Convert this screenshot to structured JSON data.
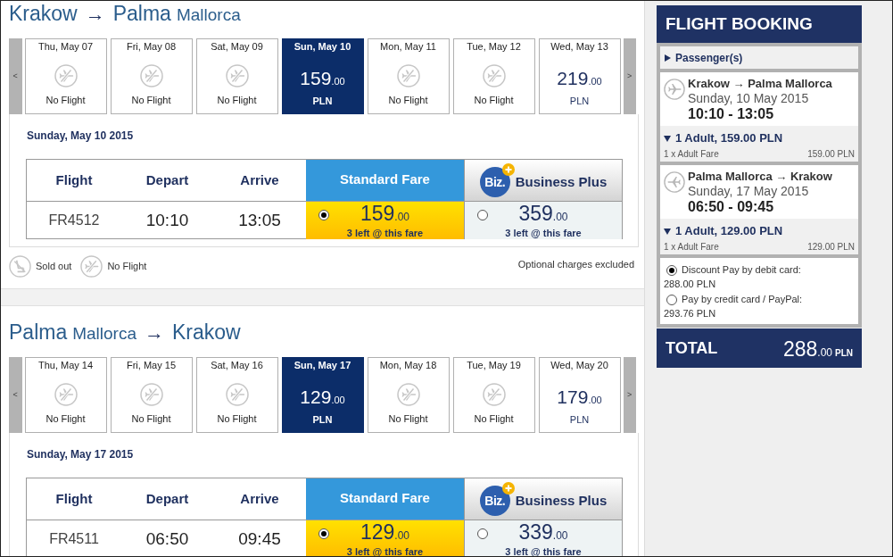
{
  "sections": [
    {
      "route": {
        "origin": {
          "city": "Krakow"
        },
        "arrow": "→",
        "destination": {
          "city": "Palma",
          "region": "Mallorca"
        }
      },
      "prev": "<",
      "next": ">",
      "days": [
        {
          "date": "Thu, May 07",
          "kind": "no_flight",
          "status": "No Flight",
          "selected": false
        },
        {
          "date": "Fri, May 08",
          "kind": "no_flight",
          "status": "No Flight",
          "selected": false
        },
        {
          "date": "Sat, May 09",
          "kind": "no_flight",
          "status": "No Flight",
          "selected": false
        },
        {
          "date": "Sun, May 10",
          "kind": "price",
          "amount": "159",
          "cents": ".00",
          "currency": "PLN",
          "selected": true
        },
        {
          "date": "Mon, May 11",
          "kind": "no_flight",
          "status": "No Flight",
          "selected": false
        },
        {
          "date": "Tue, May 12",
          "kind": "no_flight",
          "status": "No Flight",
          "selected": false
        },
        {
          "date": "Wed, May 13",
          "kind": "price",
          "amount": "219",
          "cents": ".00",
          "currency": "PLN",
          "selected": false
        }
      ],
      "heading": "Sunday, May 10 2015",
      "table": {
        "columns": [
          "Flight",
          "Depart",
          "Arrive"
        ],
        "fares": [
          {
            "kind": "standard",
            "label": "Standard Fare"
          },
          {
            "kind": "business",
            "badge": "Biz.",
            "label": "Business Plus"
          }
        ],
        "rows": [
          {
            "flight": "FR4512",
            "depart": "10:10",
            "arrive": "13:05",
            "fares": [
              {
                "amount": "159",
                "cents": ".00",
                "note": "3 left @ this fare",
                "selected": true
              },
              {
                "amount": "359",
                "cents": ".00",
                "note": "3 left @ this fare",
                "selected": false
              }
            ]
          }
        ]
      },
      "legend": [
        {
          "kind": "sold_out",
          "label": "Sold out"
        },
        {
          "kind": "no_flight",
          "label": "No Flight"
        }
      ],
      "note": "Optional charges excluded"
    },
    {
      "route": {
        "origin": {
          "city": "Palma",
          "region": "Mallorca"
        },
        "arrow": "→",
        "destination": {
          "city": "Krakow"
        }
      },
      "prev": "<",
      "next": ">",
      "days": [
        {
          "date": "Thu, May 14",
          "kind": "no_flight",
          "status": "No Flight",
          "selected": false
        },
        {
          "date": "Fri, May 15",
          "kind": "no_flight",
          "status": "No Flight",
          "selected": false
        },
        {
          "date": "Sat, May 16",
          "kind": "no_flight",
          "status": "No Flight",
          "selected": false
        },
        {
          "date": "Sun, May 17",
          "kind": "price",
          "amount": "129",
          "cents": ".00",
          "currency": "PLN",
          "selected": true
        },
        {
          "date": "Mon, May 18",
          "kind": "no_flight",
          "status": "No Flight",
          "selected": false
        },
        {
          "date": "Tue, May 19",
          "kind": "no_flight",
          "status": "No Flight",
          "selected": false
        },
        {
          "date": "Wed, May 20",
          "kind": "price",
          "amount": "179",
          "cents": ".00",
          "currency": "PLN",
          "selected": false
        }
      ],
      "heading": "Sunday, May 17 2015",
      "table": {
        "columns": [
          "Flight",
          "Depart",
          "Arrive"
        ],
        "fares": [
          {
            "kind": "standard",
            "label": "Standard Fare"
          },
          {
            "kind": "business",
            "badge": "Biz.",
            "label": "Business Plus"
          }
        ],
        "rows": [
          {
            "flight": "FR4511",
            "depart": "06:50",
            "arrive": "09:45",
            "fares": [
              {
                "amount": "129",
                "cents": ".00",
                "note": "3 left @ this fare",
                "selected": true
              },
              {
                "amount": "339",
                "cents": ".00",
                "note": "3 left @ this fare",
                "selected": false
              }
            ]
          }
        ]
      }
    }
  ],
  "booking": {
    "title": "FLIGHT BOOKING",
    "passengers": {
      "label": "Passenger(s)",
      "expanded": false
    },
    "legs": [
      {
        "kind": "outbound",
        "route": "Krakow → Palma Mallorca",
        "date": "Sunday, 10 May 2015",
        "times": "10:10 - 13:05",
        "summary": {
          "label": "1 Adult, 159.00 PLN",
          "expanded": true
        },
        "lines": [
          {
            "label": "1 x Adult Fare",
            "amount": "159.00 PLN"
          }
        ]
      },
      {
        "kind": "return",
        "route": "Palma Mallorca → Krakow",
        "date": "Sunday, 17 May 2015",
        "times": "06:50 - 09:45",
        "summary": {
          "label": "1 Adult, 129.00 PLN",
          "expanded": true
        },
        "lines": [
          {
            "label": "1 x Adult Fare",
            "amount": "129.00 PLN"
          }
        ]
      }
    ],
    "payment": [
      {
        "label": "Discount Pay by debit card:",
        "amount": "288.00 PLN",
        "selected": true
      },
      {
        "label": "Pay by credit card / PayPal:",
        "amount": "293.76 PLN",
        "selected": false
      }
    ],
    "total": {
      "label": "TOTAL",
      "amount": "288",
      "cents": ".00",
      "currency": "PLN"
    }
  }
}
